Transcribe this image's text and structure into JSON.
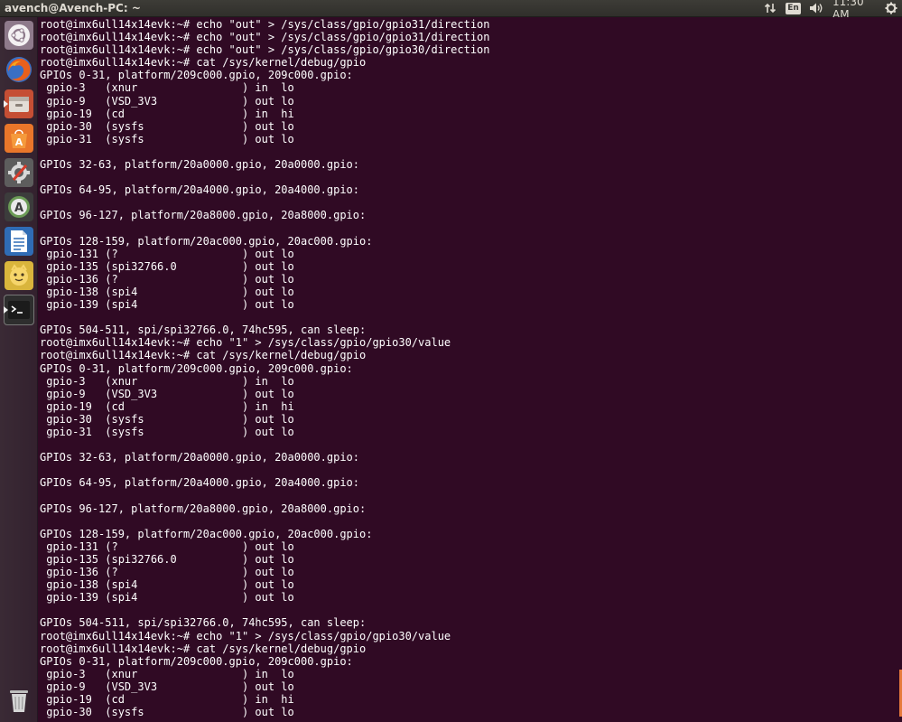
{
  "topbar": {
    "title": "avench@Avench-PC: ~",
    "keyboard_layout": "En",
    "clock": "11:30 AM"
  },
  "launcher": {
    "items": [
      {
        "icon": "ubuntu-dash-icon",
        "color": "#7a5f77"
      },
      {
        "icon": "firefox-icon",
        "color": "#e66000"
      },
      {
        "icon": "files-icon",
        "color": "#c44a2c"
      },
      {
        "icon": "software-center-icon",
        "color": "#e95420"
      },
      {
        "icon": "system-settings-icon",
        "color": "#5a5a5a"
      },
      {
        "icon": "software-updater-icon",
        "color": "#4b7a45"
      },
      {
        "icon": "libreoffice-writer-icon",
        "color": "#3d7bc2"
      },
      {
        "icon": "app-icon",
        "color": "#d4b23a"
      },
      {
        "icon": "terminal-icon",
        "color": "#3a3a3a"
      }
    ],
    "trash_icon": "trash-icon"
  },
  "terminal": {
    "lines": [
      "root@imx6ull14x14evk:~# echo \"out\" > /sys/class/gpio/gpio31/direction",
      "root@imx6ull14x14evk:~# echo \"out\" > /sys/class/gpio/gpio31/direction",
      "root@imx6ull14x14evk:~# echo \"out\" > /sys/class/gpio/gpio30/direction",
      "root@imx6ull14x14evk:~# cat /sys/kernel/debug/gpio",
      "GPIOs 0-31, platform/209c000.gpio, 209c000.gpio:",
      " gpio-3   (xnur                ) in  lo",
      " gpio-9   (VSD_3V3             ) out lo",
      " gpio-19  (cd                  ) in  hi",
      " gpio-30  (sysfs               ) out lo",
      " gpio-31  (sysfs               ) out lo",
      "",
      "GPIOs 32-63, platform/20a0000.gpio, 20a0000.gpio:",
      "",
      "GPIOs 64-95, platform/20a4000.gpio, 20a4000.gpio:",
      "",
      "GPIOs 96-127, platform/20a8000.gpio, 20a8000.gpio:",
      "",
      "GPIOs 128-159, platform/20ac000.gpio, 20ac000.gpio:",
      " gpio-131 (?                   ) out lo",
      " gpio-135 (spi32766.0          ) out lo",
      " gpio-136 (?                   ) out lo",
      " gpio-138 (spi4                ) out lo",
      " gpio-139 (spi4                ) out lo",
      "",
      "GPIOs 504-511, spi/spi32766.0, 74hc595, can sleep:",
      "root@imx6ull14x14evk:~# echo \"1\" > /sys/class/gpio/gpio30/value",
      "root@imx6ull14x14evk:~# cat /sys/kernel/debug/gpio",
      "GPIOs 0-31, platform/209c000.gpio, 209c000.gpio:",
      " gpio-3   (xnur                ) in  lo",
      " gpio-9   (VSD_3V3             ) out lo",
      " gpio-19  (cd                  ) in  hi",
      " gpio-30  (sysfs               ) out lo",
      " gpio-31  (sysfs               ) out lo",
      "",
      "GPIOs 32-63, platform/20a0000.gpio, 20a0000.gpio:",
      "",
      "GPIOs 64-95, platform/20a4000.gpio, 20a4000.gpio:",
      "",
      "GPIOs 96-127, platform/20a8000.gpio, 20a8000.gpio:",
      "",
      "GPIOs 128-159, platform/20ac000.gpio, 20ac000.gpio:",
      " gpio-131 (?                   ) out lo",
      " gpio-135 (spi32766.0          ) out lo",
      " gpio-136 (?                   ) out lo",
      " gpio-138 (spi4                ) out lo",
      " gpio-139 (spi4                ) out lo",
      "",
      "GPIOs 504-511, spi/spi32766.0, 74hc595, can sleep:",
      "root@imx6ull14x14evk:~# echo \"1\" > /sys/class/gpio/gpio30/value",
      "root@imx6ull14x14evk:~# cat /sys/kernel/debug/gpio",
      "GPIOs 0-31, platform/209c000.gpio, 209c000.gpio:",
      " gpio-3   (xnur                ) in  lo",
      " gpio-9   (VSD_3V3             ) out lo",
      " gpio-19  (cd                  ) in  hi",
      " gpio-30  (sysfs               ) out lo"
    ]
  },
  "colors": {
    "terminal_bg": "#300a24",
    "terminal_fg": "#ffffff",
    "topbar_bg": "#3c3b37",
    "accent": "#e95420"
  }
}
